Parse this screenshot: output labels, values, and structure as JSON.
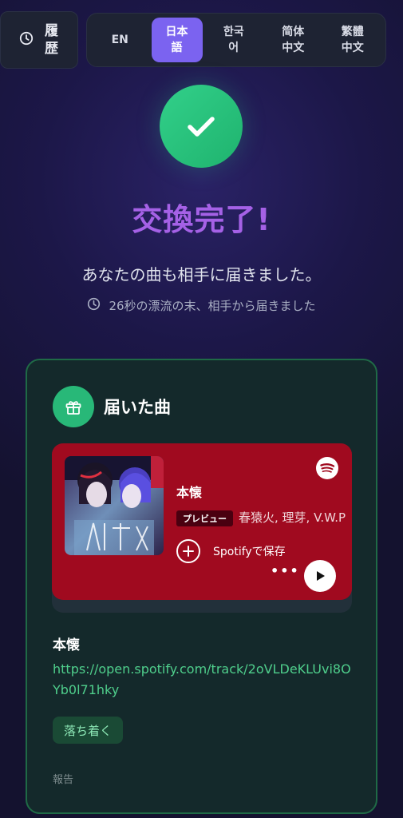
{
  "header": {
    "history_label": "履歴",
    "history_icon": "clock-icon",
    "languages": [
      {
        "label": "EN",
        "active": false
      },
      {
        "label": "日本語",
        "active": true
      },
      {
        "label": "한국어",
        "active": false
      },
      {
        "label": "简体中文",
        "active": false
      },
      {
        "label": "繁體中文",
        "active": false
      }
    ]
  },
  "result": {
    "title": "交換完了!",
    "subtitle": "あなたの曲も相手に届きました。",
    "drift_text": "26秒の漂流の末、相手から届きました"
  },
  "received": {
    "heading": "届いた曲",
    "embed": {
      "title": "本懐",
      "badge": "プレビュー",
      "artists": "春猿火, 理芽, V.W.P",
      "save_label": "Spotifyで保存",
      "more": "•••"
    },
    "track_name": "本懐",
    "link": "https://open.spotify.com/track/2oVLDeKLUvi8OYb0l71hky",
    "mood": "落ち着く",
    "report": "報告"
  },
  "colors": {
    "accent": "#7b63f0",
    "title": "#a561e6",
    "success": "#28b878",
    "spotify_card": "#a00a1f",
    "link": "#4fcf8c"
  }
}
